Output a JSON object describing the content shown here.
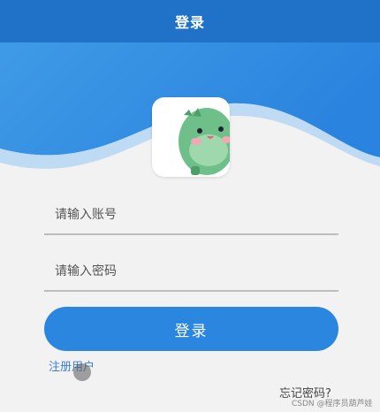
{
  "header": {
    "title": "登录"
  },
  "form": {
    "account_placeholder": "请输入账号",
    "password_placeholder": "请输入密码",
    "login_label": "登录"
  },
  "links": {
    "register": "注册用户",
    "forgot": "忘记密码?"
  },
  "avatar": {
    "icon": "dinosaur-mascot-icon"
  },
  "watermark": "CSDN @程序员葫芦娃",
  "colors": {
    "header": "#1f72c8",
    "wave": "#2d8ae3",
    "button": "#2a86de",
    "link": "#3d7fcf"
  }
}
